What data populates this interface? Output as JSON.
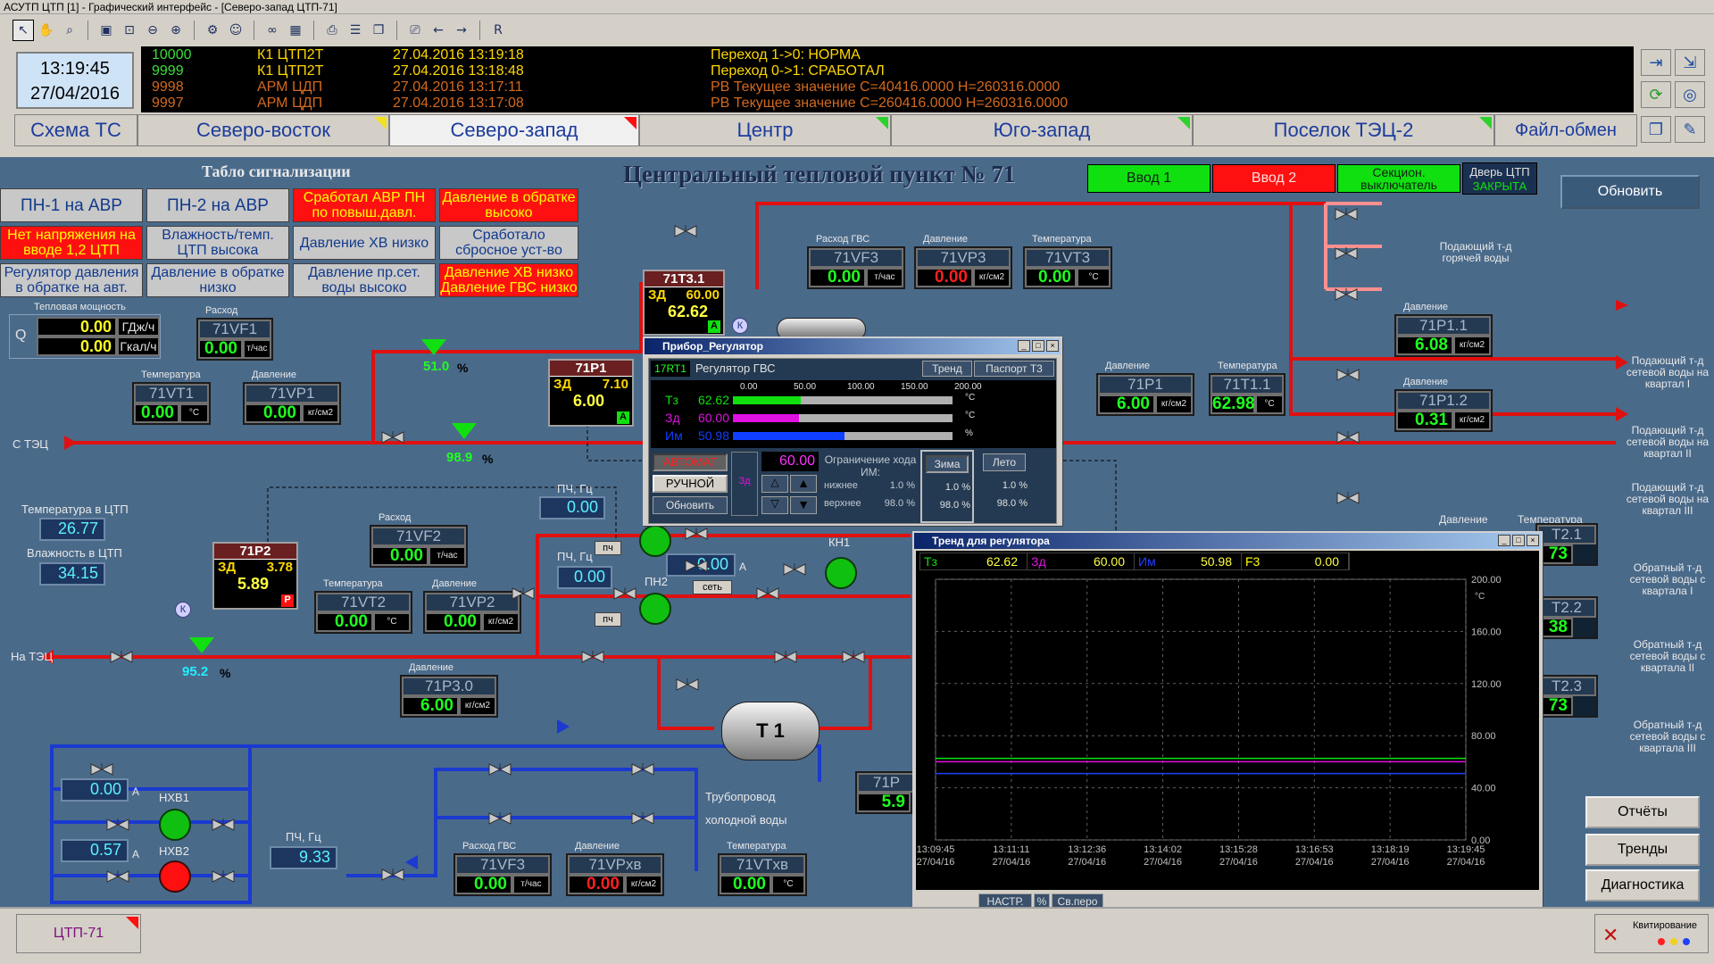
{
  "window": {
    "title": "АСУТП ЦТП [1] - Графический интерфейс - [Северо-запад ЦТП-71]"
  },
  "toolbar": {
    "extra_label": "R"
  },
  "clock": {
    "time": "13:19:45",
    "date": "27/04/2016"
  },
  "events": [
    {
      "num": "10000",
      "src": "К1 ЦТП2Т",
      "ts": "27.04.2016 13:19:18",
      "msg": "Переход  1->0:  НОРМА"
    },
    {
      "num": "9999",
      "src": "К1 ЦТП2Т",
      "ts": "27.04.2016 13:18:48",
      "msg": "Переход  0->1:  СРАБОТАЛ"
    },
    {
      "num": "9998",
      "src": "АРМ ЦДП",
      "ts": "27.04.2016 13:17:11",
      "msg": "РВ Текущее значение С=40416.0000 Н=260316.0000"
    },
    {
      "num": "9997",
      "src": "АРМ ЦДП",
      "ts": "27.04.2016 13:17:08",
      "msg": "РВ Текущее значение С=260416.0000 Н=260316.0000"
    }
  ],
  "tabs": [
    {
      "label": "Схема ТС",
      "flag": ""
    },
    {
      "label": "Северо-восток",
      "flag": "y"
    },
    {
      "label": "Северо-запад",
      "flag": "r"
    },
    {
      "label": "Центр",
      "flag": "g"
    },
    {
      "label": "Юго-запад",
      "flag": "g"
    },
    {
      "label": "Поселок ТЭЦ-2",
      "flag": "g"
    },
    {
      "label": "Файл-обмен",
      "flag": ""
    }
  ],
  "alarm_board": {
    "title": "Табло сигнализации",
    "cells": [
      "ПН-1 на АВР",
      "ПН-2 на АВР",
      "Сработал АВР ПН по повыш.давл.",
      "Давление в обратке высоко",
      "Нет напряжения на вводе 1,2 ЦТП",
      "Влажность/темп. ЦТП высока",
      "Давление ХВ низко",
      "Сработало сбросное уст-во",
      "Регулятор давления в обратке на авт.",
      "Давление в обратке низко",
      "Давление пр.сет. воды высоко",
      "Давление ХВ низко Давление ГВС низко"
    ]
  },
  "header": {
    "title": "Центральный тепловой пункт № 71",
    "vvod1": "Ввод 1",
    "vvod2": "Ввод 2",
    "sect": "Секцион. выключатель",
    "door": "Дверь ЦТП",
    "door_state": "ЗАКРЫТА",
    "refresh": "Обновить"
  },
  "colors": {
    "ok": "#10e010",
    "alarm": "#ff1010",
    "pipe_hot": "#e01010",
    "pipe_cold": "#1a3ad0",
    "pipe_hw": "#ff8080"
  },
  "heat": {
    "caption": "Тепловая мощность",
    "q_label": "Q",
    "v1": "0.00",
    "u1": "ГДж/ч",
    "v2": "0.00",
    "u2": "Гкал/ч"
  },
  "instruments": {
    "vf1": {
      "cap": "Расход",
      "name": "71VF1",
      "val": "0.00",
      "unit": "т/час"
    },
    "vt1": {
      "cap": "Температура",
      "name": "71VT1",
      "val": "0.00",
      "unit": "°С"
    },
    "vp1": {
      "cap": "Давление",
      "name": "71VP1",
      "val": "0.00",
      "unit": "кг/см2"
    },
    "vf3a": {
      "cap": "Расход ГВС",
      "name": "71VF3",
      "val": "0.00",
      "unit": "т/час"
    },
    "vp3": {
      "cap": "Давление",
      "name": "71VP3",
      "val": "0.00",
      "unit": "кг/см2"
    },
    "vt3": {
      "cap": "Температура",
      "name": "71VT3",
      "val": "0.00",
      "unit": "°С"
    },
    "vf2": {
      "cap": "Расход",
      "name": "71VF2",
      "val": "0.00",
      "unit": "т/час"
    },
    "vt2": {
      "cap": "Температура",
      "name": "71VT2",
      "val": "0.00",
      "unit": "°С"
    },
    "vp2": {
      "cap": "Давление",
      "name": "71VP2",
      "val": "0.00",
      "unit": "кг/см2"
    },
    "p30": {
      "cap": "Давление",
      "name": "71P3.0",
      "val": "6.00",
      "unit": "кг/см2"
    },
    "p1": {
      "cap": "Давление",
      "name": "71P1",
      "val": "6.00",
      "unit": "кг/см2"
    },
    "t11": {
      "cap": "Температура",
      "name": "71T1.1",
      "val": "62.98",
      "unit": "°С"
    },
    "p11": {
      "cap": "Давление",
      "name": "71P1.1",
      "val": "6.08",
      "unit": "кг/см2"
    },
    "p12": {
      "cap": "Давление",
      "name": "71P1.2",
      "val": "0.31",
      "unit": "кг/см2"
    },
    "vf3b": {
      "cap": "Расход ГВС",
      "name": "71VF3",
      "val": "0.00",
      "unit": "т/час"
    },
    "vpxv": {
      "cap": "Давление",
      "name": "71VPхв",
      "val": "0.00",
      "unit": "кг/см2"
    },
    "vtxv": {
      "cap": "Температура",
      "name": "71VTхв",
      "val": "0.00",
      "unit": "°С"
    }
  },
  "env": {
    "t_label": "Температура в ЦТП",
    "t_val": "26.77",
    "h_label": "Влажность в ЦТП",
    "h_val": "34.15"
  },
  "labels": {
    "from_tec": "С ТЭЦ",
    "to_tec": "На ТЭЦ",
    "hot_supply": "Подающий т-д горячей воды",
    "sup1": "Подающий т-д сетевой воды на квартал I",
    "sup2": "Подающий т-д сетевой воды на квартал II",
    "sup3": "Подающий т-д сетевой воды на квартал III",
    "ret1": "Обратный т-д сетевой воды с квартала I",
    "ret2": "Обратный т-д сетевой воды с квартала II",
    "ret3": "Обратный т-д сетевой воды с квартала III",
    "cold_pipe": "Трубопровод холодной воды",
    "tank": "Т 1",
    "kn1": "КН1",
    "pn2": "ПН2",
    "hv1": "НХВ1",
    "hv2": "НХВ2",
    "pch": "ПЧ, Гц",
    "pch_btn": "пч",
    "set_btn": "сеть",
    "pch1": "0.00",
    "pch2": "0.00",
    "amp": "0.00",
    "hv1_a": "0.00",
    "hv2_a": "0.57",
    "pch_hv": "9.33",
    "valve1_pct": "51.0",
    "valve2_pct": "98.9",
    "valve3_pct": "95.2",
    "pct": "%",
    "a_unit": "А",
    "k": "К",
    "side1": "Давление",
    "side2": "Температура",
    "partial1": "73",
    "partial2": "38",
    "partial3": "73",
    "partial_t21": "Т2.1",
    "partial_t22": "Т2.2",
    "partial_t23": "Т2.3",
    "partial_p": "71Р",
    "partial_v": "5.9"
  },
  "controllers": {
    "t31": {
      "name": "71Т3.1",
      "zd_label": "ЗД",
      "zd": "60.00",
      "val": "62.62",
      "mode": "А"
    },
    "p1c": {
      "name": "71Р1",
      "zd_label": "ЗД",
      "zd": "7.10",
      "val": "6.00",
      "mode": "А"
    },
    "p2c": {
      "name": "71Р2",
      "zd_label": "ЗД",
      "zd": "3.78",
      "val": "5.89",
      "mode": "Р"
    }
  },
  "regulator": {
    "title": "Прибор_Регулятор",
    "tag": "17RT1",
    "name": "Регулятор ГВС",
    "btn_trend": "Тренд",
    "btn_passport": "Паспорт Т3",
    "scale": [
      "0.00",
      "50.00",
      "100.00",
      "150.00",
      "200.00"
    ],
    "rows": [
      {
        "label": "Тз",
        "val": "62.62",
        "unit": "°С",
        "frac": 0.31,
        "color": "#10e010"
      },
      {
        "label": "Зд",
        "val": "60.00",
        "unit": "°С",
        "frac": 0.3,
        "color": "#e010e0"
      },
      {
        "label": "Им",
        "val": "50.98",
        "unit": "%",
        "frac": 0.51,
        "color": "#1040ff"
      }
    ],
    "auto": "АВТОМАТ",
    "manual": "РУЧНОЙ",
    "refresh": "Обновить",
    "zd_mark": "Зд",
    "setpoint": "60.00",
    "limit_title": "Ограничение хода ИМ:",
    "lower": "нижнее",
    "upper": "верхнее",
    "lower_val": "1.0 %",
    "upper_val": "98.0 %",
    "winter": "Зима",
    "summer": "Лето",
    "w_low": "1.0 %",
    "w_up": "98.0 %",
    "s_low": "1.0 %",
    "s_up": "98.0 %"
  },
  "trend": {
    "title": "Тренд для регулятора",
    "legend": [
      {
        "label": "Тз",
        "val": "62.62",
        "color": "#10e010"
      },
      {
        "label": "Зд",
        "val": "60.00",
        "color": "#e010e0"
      },
      {
        "label": "Им",
        "val": "50.98",
        "color": "#2040ff"
      },
      {
        "label": "F3",
        "val": "0.00",
        "color": "#ffff00"
      }
    ],
    "y_ticks": [
      "200.00",
      "160.00",
      "120.00",
      "80.00",
      "40.00",
      "0.00"
    ],
    "y_unit": "°С",
    "x_times": [
      "13:09:45",
      "13:11:11",
      "13:12:36",
      "13:14:02",
      "13:15:28",
      "13:16:53",
      "13:18:19",
      "13:19:45"
    ],
    "x_date": "27/04/16",
    "btn_setup": "НАСТР.",
    "btn_pct": "%",
    "btn_pen": "Св.перо"
  },
  "chart_data": {
    "type": "line",
    "title": "",
    "ylim": [
      0,
      200
    ],
    "x": [
      "13:09:45",
      "13:11:11",
      "13:12:36",
      "13:14:02",
      "13:15:28",
      "13:16:53",
      "13:18:19",
      "13:19:45"
    ],
    "series": [
      {
        "name": "Тз",
        "values": [
          62.62,
          62.62,
          62.62,
          62.62,
          62.62,
          62.62,
          62.62,
          62.62
        ]
      },
      {
        "name": "Зд",
        "values": [
          60.0,
          60.0,
          60.0,
          60.0,
          60.0,
          60.0,
          60.0,
          60.0
        ]
      },
      {
        "name": "Им",
        "values": [
          50.98,
          50.98,
          50.98,
          50.98,
          50.98,
          50.98,
          50.98,
          50.98
        ]
      }
    ]
  },
  "right_buttons": {
    "reports": "Отчёты",
    "trends": "Тренды",
    "diag": "Диагностика"
  },
  "status": {
    "tab": "ЦТП-71",
    "ack": "Квитирование"
  }
}
